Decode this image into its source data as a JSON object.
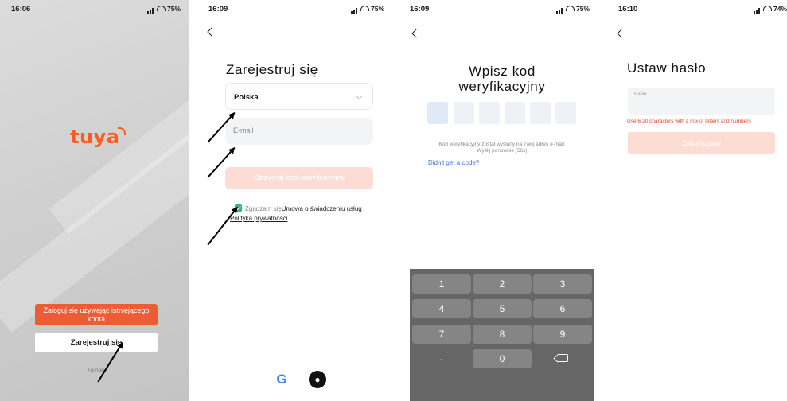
{
  "panel1": {
    "status": {
      "time": "16:06",
      "battery": "75%"
    },
    "logo_text": "tuya",
    "login_button": "Zaloguj się używając istniejącego konta",
    "register_button": "Zarejestruj się",
    "try_now": "Try now"
  },
  "panel2": {
    "status": {
      "time": "16:09",
      "battery": "75%"
    },
    "title": "Zarejestruj się",
    "country_value": "Polska",
    "email_placeholder": "E-mail",
    "get_code_button": "Otrzymaj kod weryfikacyjny",
    "agree_text": "Zgadzam się",
    "terms_link": "Umowa o świadczeniu usług",
    "privacy_link": "Polityka prywatności",
    "google_icon": "G"
  },
  "panel3": {
    "status": {
      "time": "16:09",
      "battery": "75%"
    },
    "title_line1": "Wpisz kod",
    "title_line2": "weryfikacyjny",
    "sent_line1": "Kod weryfikacyjny został wysłany na Twój adres e-mail:",
    "sent_line2": "Wyślij ponownie (56s)",
    "didnt_get": "Didn't get a code?",
    "keys": [
      "1",
      "2",
      "3",
      "4",
      "5",
      "6",
      "7",
      "8",
      "9",
      "",
      "0",
      ""
    ]
  },
  "panel4": {
    "status": {
      "time": "16:10",
      "battery": "74%"
    },
    "title": "Ustaw hasło",
    "password_label": "Hasło",
    "hint": "Use 6-20 characters with a mix of letters and numbers",
    "done_button": "Zakończono"
  },
  "colors": {
    "brand_orange": "#ed5d35",
    "disabled_button": "#fcdcd3",
    "checkbox_green": "#2fb679",
    "link_blue": "#3377dd",
    "error_red": "#e2452c"
  }
}
